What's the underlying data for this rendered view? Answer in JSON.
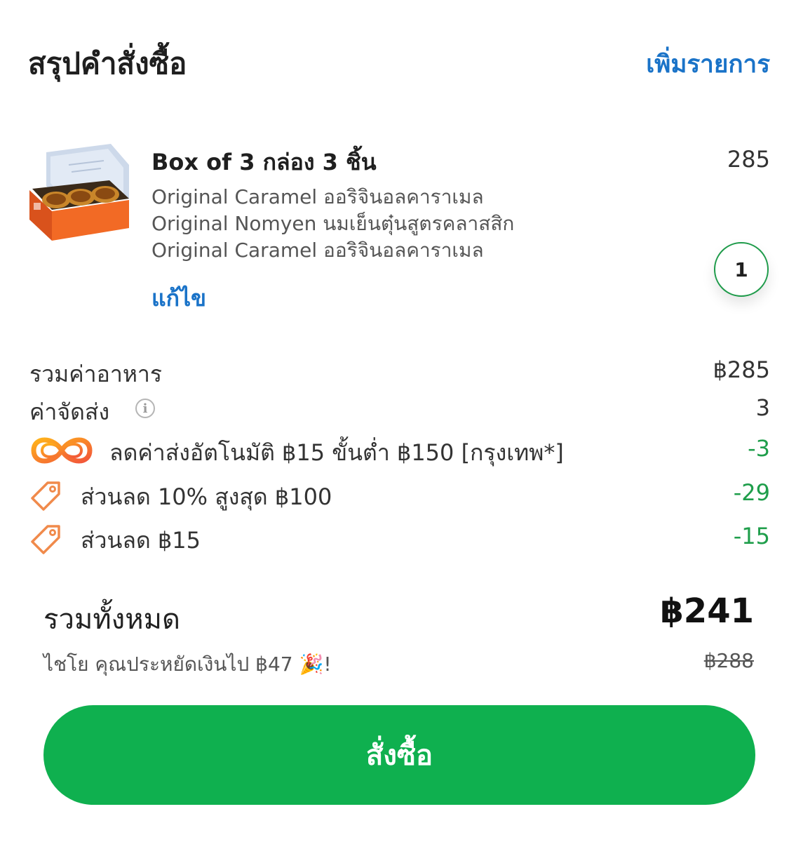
{
  "header": {
    "title": "สรุปคำสั่งซื้อ",
    "add_items_label": "เพิ่มรายการ"
  },
  "item": {
    "name": "Box of 3 กล่อง 3 ชิ้น",
    "price": "285",
    "options": [
      "Original Caramel ออริจินอลคาราเมล",
      "Original Nomyen นมเย็นตุ๋นสูตรคลาสสิก",
      "Original Caramel ออริจินอลคาราเมล"
    ],
    "edit_label": "แก้ไข",
    "quantity": "1",
    "image_icon": "pastry-box-image"
  },
  "summary": {
    "food_total_label": "รวมค่าอาหาร",
    "food_total_value": "฿285",
    "delivery_fee_label": "ค่าจัดส่ง",
    "delivery_fee_value": "3",
    "discounts": [
      {
        "icon": "auto-delivery-discount-icon",
        "label": "ลดค่าส่งอัตโนมัติ ฿15 ขั้นต่ำ ฿150 [กรุงเทพ*]",
        "value": "-3"
      },
      {
        "icon": "tag-icon",
        "label": "ส่วนลด 10% สูงสุด ฿100",
        "value": "-29"
      },
      {
        "icon": "tag-icon",
        "label": "ส่วนลด  ฿15",
        "value": "-15"
      }
    ]
  },
  "total": {
    "label": "รวมทั้งหมด",
    "value": "฿241",
    "savings_text": "ไชโย คุณประหยัดเงินไป  ฿47 🎉!",
    "original_value": "฿288"
  },
  "order_button": {
    "label": "สั่งซื้อ"
  },
  "colors": {
    "accent_blue": "#1a73c8",
    "discount_green": "#1f9e4b",
    "button_green": "#0fb04f",
    "tag_orange": "#f08a4b"
  }
}
